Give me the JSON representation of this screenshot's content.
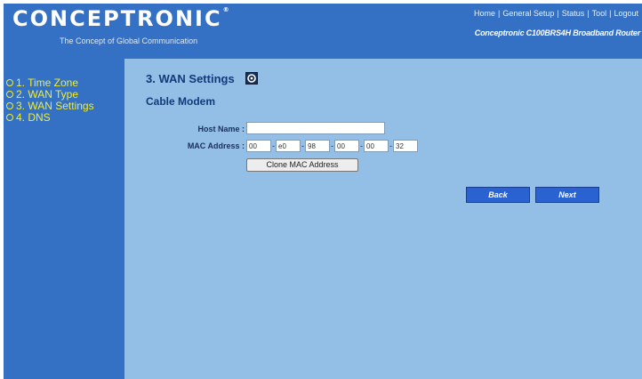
{
  "brand": {
    "logo_text": "CONCEPTRONIC",
    "registered_mark": "®",
    "tagline": "The Concept of Global Communication"
  },
  "topnav": {
    "items": [
      "Home",
      "General Setup",
      "Status",
      "Tool",
      "Logout"
    ],
    "separator": "|"
  },
  "model_name": "Conceptronic C100BRS4H Broadband Router",
  "sidebar": {
    "items": [
      {
        "label": "1. Time Zone"
      },
      {
        "label": "2. WAN Type"
      },
      {
        "label": "3. WAN Settings"
      },
      {
        "label": "4. DNS"
      }
    ]
  },
  "page": {
    "title": "3. WAN Settings",
    "subtitle": "Cable Modem"
  },
  "form": {
    "host_name_label": "Host Name :",
    "host_name_value": "",
    "mac_label": "MAC Address :",
    "mac_fields": [
      "00",
      "e0",
      "98",
      "00",
      "00",
      "32"
    ],
    "mac_separator": "-",
    "clone_button": "Clone MAC Address"
  },
  "buttons": {
    "back": "Back",
    "next": "Next"
  },
  "icons": {
    "help": "help-icon",
    "bullet": "circle-bullet-icon"
  },
  "colors": {
    "header_blue": "#3470c4",
    "content_blue": "#93bfe6",
    "menu_yellow": "#f2ee2c",
    "button_blue": "#2a62d2"
  }
}
